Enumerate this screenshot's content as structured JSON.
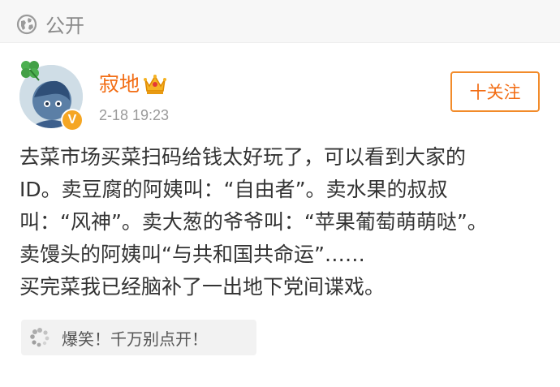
{
  "visibility": {
    "label": "公开",
    "icon": "globe-icon"
  },
  "post": {
    "author": {
      "name": "寂地",
      "badge_icon": "crown-icon",
      "verified_icon": "verified-v-icon",
      "verified_letter": "V"
    },
    "timestamp": "2-18 19:23",
    "follow_button_label": "十关注",
    "text_lines": [
      "去菜市场买菜扫码给钱太好玩了，可以看到大家的",
      "ID。卖豆腐的阿姨叫：“自由者”。卖水果的叔叔",
      "叫：“风神”。卖大葱的爷爷叫：“苹果葡萄萌萌哒”。",
      "卖馒头的阿姨叫“与共和国共命运”……",
      "买完菜我已经脑补了一出地下党间谍戏。"
    ],
    "link_card": {
      "icon": "loading-spinner-icon",
      "label": "爆笑！千万别点开！"
    }
  },
  "colors": {
    "accent": "#f26d14",
    "button_border": "#f28b2a",
    "verified": "#f5a623",
    "muted": "#9a9a9a"
  }
}
